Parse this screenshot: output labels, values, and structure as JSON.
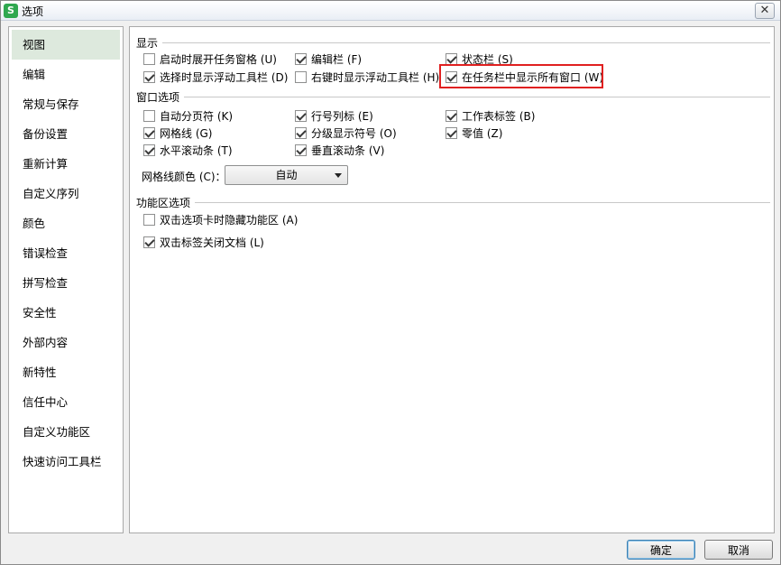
{
  "window": {
    "title": "选项",
    "app_icon_letter": "S",
    "close_glyph": "✕"
  },
  "sidebar": {
    "items": [
      {
        "label": "视图",
        "selected": true
      },
      {
        "label": "编辑"
      },
      {
        "label": "常规与保存"
      },
      {
        "label": "备份设置"
      },
      {
        "label": "重新计算"
      },
      {
        "label": "自定义序列"
      },
      {
        "label": "颜色"
      },
      {
        "label": "错误检查"
      },
      {
        "label": "拼写检查"
      },
      {
        "label": "安全性"
      },
      {
        "label": "外部内容"
      },
      {
        "label": "新特性"
      },
      {
        "label": "信任中心"
      },
      {
        "label": "自定义功能区"
      },
      {
        "label": "快速访问工具栏"
      }
    ]
  },
  "display": {
    "title": "显示",
    "options": [
      {
        "label": "启动时展开任务窗格 (U)",
        "checked": false
      },
      {
        "label": "编辑栏 (F)",
        "checked": true
      },
      {
        "label": "状态栏 (S)",
        "checked": true
      },
      {
        "label": "选择时显示浮动工具栏 (D)",
        "checked": true
      },
      {
        "label": "右键时显示浮动工具栏 (H)",
        "checked": false
      },
      {
        "label": "在任务栏中显示所有窗口 (W)",
        "checked": true
      }
    ]
  },
  "window_options": {
    "title": "窗口选项",
    "options": [
      {
        "label": "自动分页符 (K)",
        "checked": false
      },
      {
        "label": "行号列标 (E)",
        "checked": true
      },
      {
        "label": "工作表标签 (B)",
        "checked": true
      },
      {
        "label": "网格线 (G)",
        "checked": true
      },
      {
        "label": "分级显示符号 (O)",
        "checked": true
      },
      {
        "label": "零值 (Z)",
        "checked": true
      },
      {
        "label": "水平滚动条 (T)",
        "checked": true
      },
      {
        "label": "垂直滚动条 (V)",
        "checked": true
      }
    ],
    "gridline_color_label": "网格线颜色 (C)：",
    "gridline_color_value": "自动"
  },
  "ribbon_options": {
    "title": "功能区选项",
    "options": [
      {
        "label": "双击选项卡时隐藏功能区 (A)",
        "checked": false
      },
      {
        "label": "双击标签关闭文档 (L)",
        "checked": true
      }
    ]
  },
  "buttons": {
    "ok": "确定",
    "cancel": "取消"
  },
  "colors": {
    "highlight_border": "#e02020",
    "selected_sidebar_bg": "#dde9dd",
    "app_icon_green": "#2fa84f"
  }
}
